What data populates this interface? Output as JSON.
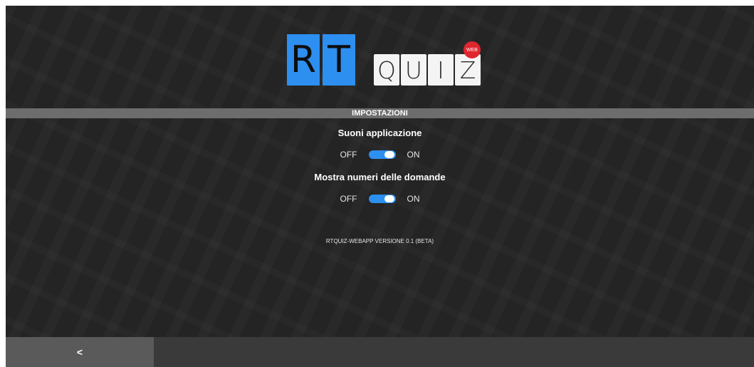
{
  "logo": {
    "letters_big": [
      "R",
      "T"
    ],
    "letters_small": [
      "Q",
      "U",
      "I",
      "Z"
    ],
    "badge": "WEB"
  },
  "section_title": "IMPOSTAZIONI",
  "settings": [
    {
      "title": "Suoni applicazione",
      "off_label": "OFF",
      "on_label": "ON",
      "enabled": true
    },
    {
      "title": "Mostra numeri delle domande",
      "off_label": "OFF",
      "on_label": "ON",
      "enabled": true
    }
  ],
  "version": "RTQUIZ-WEBAPP VERSIONE 0.1 (BETA)",
  "footer": {
    "back_label": "<"
  },
  "colors": {
    "accent": "#2d8ff0",
    "background": "#262626",
    "badge": "#e0262f"
  }
}
